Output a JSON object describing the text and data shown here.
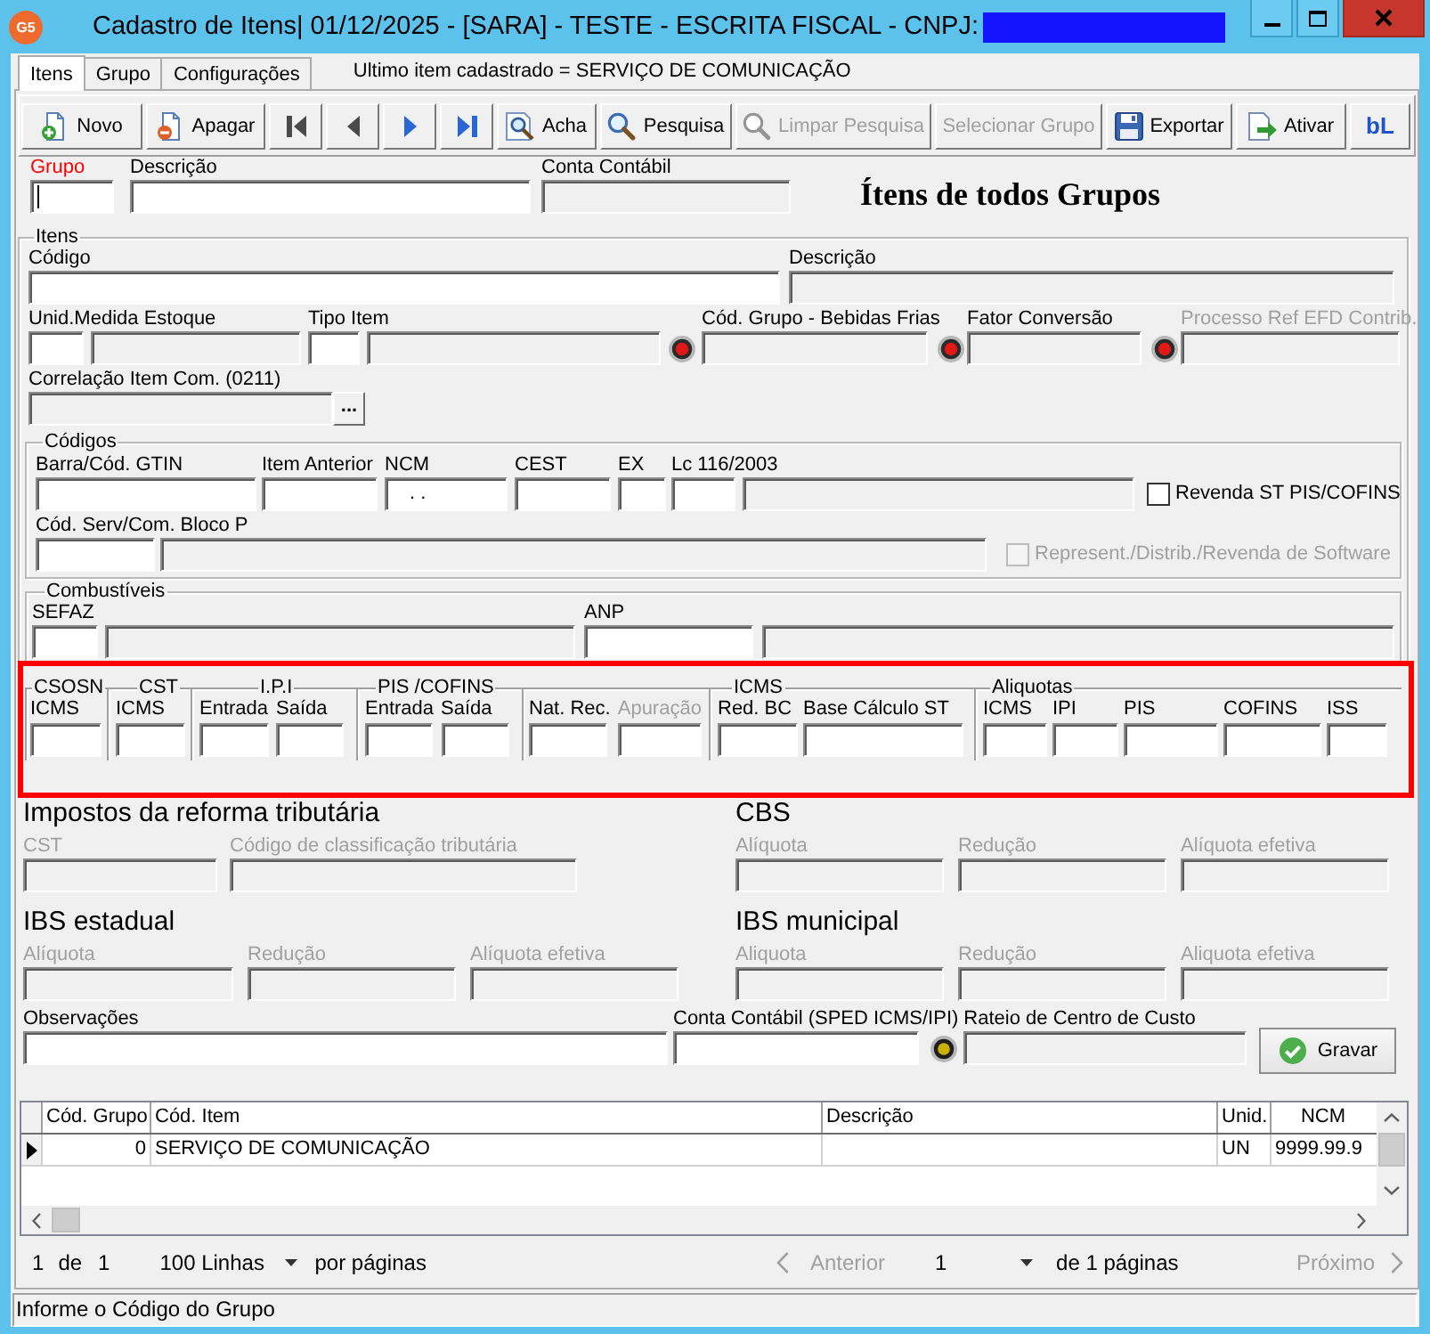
{
  "window": {
    "logo": "G5",
    "title": "Cadastro de Itens| 01/12/2025 - [SARA] - TESTE - ESCRITA FISCAL - CNPJ:"
  },
  "tabs": [
    {
      "label": "Itens",
      "selected": true
    },
    {
      "label": "Grupo",
      "selected": false
    },
    {
      "label": "Configurações",
      "selected": false
    }
  ],
  "last_item_note": "Ultimo item cadastrado = SERVIÇO DE COMUNICAÇÃO",
  "toolbar": [
    {
      "kind": "text",
      "label": "Novo",
      "disabled": false
    },
    {
      "kind": "text",
      "label": "Apagar",
      "disabled": false
    },
    {
      "kind": "icon",
      "disabled": true
    },
    {
      "kind": "icon",
      "disabled": true
    },
    {
      "kind": "icon",
      "disabled": false
    },
    {
      "kind": "icon",
      "disabled": false
    },
    {
      "kind": "text",
      "label": "Acha",
      "disabled": false
    },
    {
      "kind": "text",
      "label": "Pesquisa",
      "disabled": false
    },
    {
      "kind": "text",
      "label": "Limpar Pesquisa",
      "disabled": true
    },
    {
      "kind": "text",
      "label": "Selecionar Grupo",
      "disabled": true
    },
    {
      "kind": "text",
      "label": "Exportar",
      "disabled": false
    },
    {
      "kind": "text",
      "label": "Ativar",
      "disabled": false
    },
    {
      "kind": "logo",
      "label": "bL",
      "disabled": false
    }
  ],
  "header": {
    "grupo": {
      "label": "Grupo",
      "required": true,
      "readonly": false,
      "focused": true
    },
    "descricao": {
      "label": "Descrição",
      "required": false,
      "readonly": false,
      "focused": false
    },
    "conta_contabil": {
      "label": "Conta Contábil",
      "required": false,
      "readonly": true,
      "focused": false
    },
    "heading": "Ítens de todos Grupos"
  },
  "itens": {
    "legend": "Itens",
    "codigo": {
      "label": "Código",
      "readonly": false
    },
    "descricao": {
      "label": "Descrição",
      "readonly": true
    },
    "unid_medida": {
      "label": "Unid.Medida Estoque",
      "readonly": false
    },
    "unid_medida_descricao": {
      "readonly": true
    },
    "tipo_item": {
      "label": "Tipo Item",
      "readonly": false
    },
    "tipo_item_descricao": {
      "readonly": true
    },
    "cod_grupo_bebidas": {
      "label": "Cód. Grupo - Bebidas Frias",
      "readonly": true
    },
    "fator_conversao": {
      "label": "Fator Conversão",
      "readonly": true
    },
    "processo_ref": {
      "label": "Processo Ref EFD Contrib.",
      "disabled": true,
      "readonly": true
    },
    "correlacao": {
      "label": "Correlação Item Com. (0211)",
      "readonly": true,
      "button": "..."
    },
    "codigos": {
      "legend": "Códigos",
      "gtin": {
        "label": "Barra/Cód. GTIN",
        "readonly": false
      },
      "item_anterior": {
        "label": "Item Anterior",
        "readonly": false
      },
      "ncm": {
        "label": "NCM",
        "readonly": false,
        "value": ". ."
      },
      "cest": {
        "label": "CEST",
        "readonly": false
      },
      "ex": {
        "label": "EX",
        "readonly": false
      },
      "lc116": {
        "label": "Lc 116/2003",
        "readonly": false
      },
      "lc116_descricao": {
        "readonly": true
      },
      "revenda_st": {
        "label": "Revenda ST PIS/COFINS",
        "checked": false,
        "disabled": false
      },
      "bloco_p": {
        "label": "Cód. Serv/Com. Bloco P",
        "readonly": false
      },
      "bloco_p_descricao": {
        "readonly": true
      },
      "software": {
        "label": "Represent./Distrib./Revenda de Software",
        "checked": false,
        "disabled": true
      }
    },
    "combustiveis": {
      "legend": "Combustíveis",
      "sefaz": {
        "label": "SEFAZ",
        "readonly": false
      },
      "sefaz_descricao": {
        "readonly": true
      },
      "anp": {
        "label": "ANP",
        "readonly": false
      },
      "anp_descricao": {
        "readonly": true
      }
    }
  },
  "tributos": [
    {
      "legend": "CSOSN",
      "fields": [
        {
          "label": "ICMS",
          "disabled": false,
          "readonly": false
        }
      ]
    },
    {
      "legend": "CST",
      "fields": [
        {
          "label": "ICMS",
          "disabled": false,
          "readonly": false
        }
      ]
    },
    {
      "legend": "I.P.I",
      "fields": [
        {
          "label": "Entrada",
          "disabled": false,
          "readonly": false
        },
        {
          "label": "Saída",
          "disabled": false,
          "readonly": false
        }
      ]
    },
    {
      "legend": "PIS /COFINS",
      "fields": [
        {
          "label": "Entrada",
          "disabled": false,
          "readonly": false
        },
        {
          "label": "Saída",
          "disabled": false,
          "readonly": false
        }
      ]
    },
    {
      "fields": [
        {
          "label": "Nat. Rec.",
          "disabled": false,
          "readonly": false
        },
        {
          "label": "Apuração",
          "disabled": true,
          "readonly": false
        }
      ]
    },
    {
      "legend": "ICMS",
      "fields": [
        {
          "label": "Red. BC",
          "disabled": false,
          "readonly": false
        },
        {
          "label": "Base Cálculo ST",
          "disabled": false,
          "readonly": false
        }
      ]
    },
    {
      "legend": "Aliquotas",
      "fields": [
        {
          "label": "ICMS",
          "disabled": false,
          "readonly": false
        },
        {
          "label": "IPI",
          "disabled": false,
          "readonly": false
        },
        {
          "label": "PIS",
          "disabled": false,
          "readonly": false
        },
        {
          "label": "COFINS",
          "disabled": false,
          "readonly": false
        },
        {
          "label": "ISS",
          "disabled": false,
          "readonly": false
        }
      ]
    }
  ],
  "reforma": [
    {
      "title": "Impostos da reforma tributária",
      "fields": [
        {
          "label": "CST",
          "disabled": true,
          "readonly": true
        },
        {
          "label": "Código de classificação tributária",
          "disabled": true,
          "readonly": true
        }
      ]
    },
    {
      "title": "CBS",
      "fields": [
        {
          "label": "Alíquota",
          "disabled": true,
          "readonly": true
        },
        {
          "label": "Redução",
          "disabled": true,
          "readonly": true
        },
        {
          "label": "Alíquota efetiva",
          "disabled": true,
          "readonly": true
        }
      ]
    },
    {
      "title": "IBS estadual",
      "fields": [
        {
          "label": "Alíquota",
          "disabled": true,
          "readonly": true
        },
        {
          "label": "Redução",
          "disabled": true,
          "readonly": true
        },
        {
          "label": "Alíquota efetiva",
          "disabled": true,
          "readonly": true
        }
      ]
    },
    {
      "title": "IBS municipal",
      "fields": [
        {
          "label": "Aliquota",
          "disabled": true,
          "readonly": true
        },
        {
          "label": "Redução",
          "disabled": true,
          "readonly": true
        },
        {
          "label": "Aliquota efetiva",
          "disabled": true,
          "readonly": true
        }
      ]
    }
  ],
  "observacoes": {
    "label": "Observações",
    "readonly": false
  },
  "conta_sped": {
    "label": "Conta Contábil (SPED ICMS/IPI)",
    "readonly": false
  },
  "rateio": {
    "label": "Rateio de Centro de Custo",
    "readonly": true
  },
  "save_button": {
    "label": "Gravar",
    "disabled": false
  },
  "grid": {
    "columns": [
      "Cód. Grupo",
      "Cód. Item",
      "Descrição",
      "Unid.",
      "NCM"
    ],
    "rows": [
      {
        "selected": true,
        "cells": [
          "0",
          "SERVIÇO DE COMUNICAÇÃO",
          null,
          "UN",
          "9999.99.9"
        ]
      }
    ]
  },
  "pagination": {
    "current": "1",
    "of": "de",
    "total": "1",
    "page_size": "100 Linhas",
    "per_page": "por páginas",
    "previous": {
      "label": "Anterior",
      "disabled": true
    },
    "page": "1",
    "page_count": "de 1 páginas",
    "next": {
      "label": "Próximo",
      "disabled": true
    }
  },
  "status_bar": "Informe o Código do Grupo"
}
